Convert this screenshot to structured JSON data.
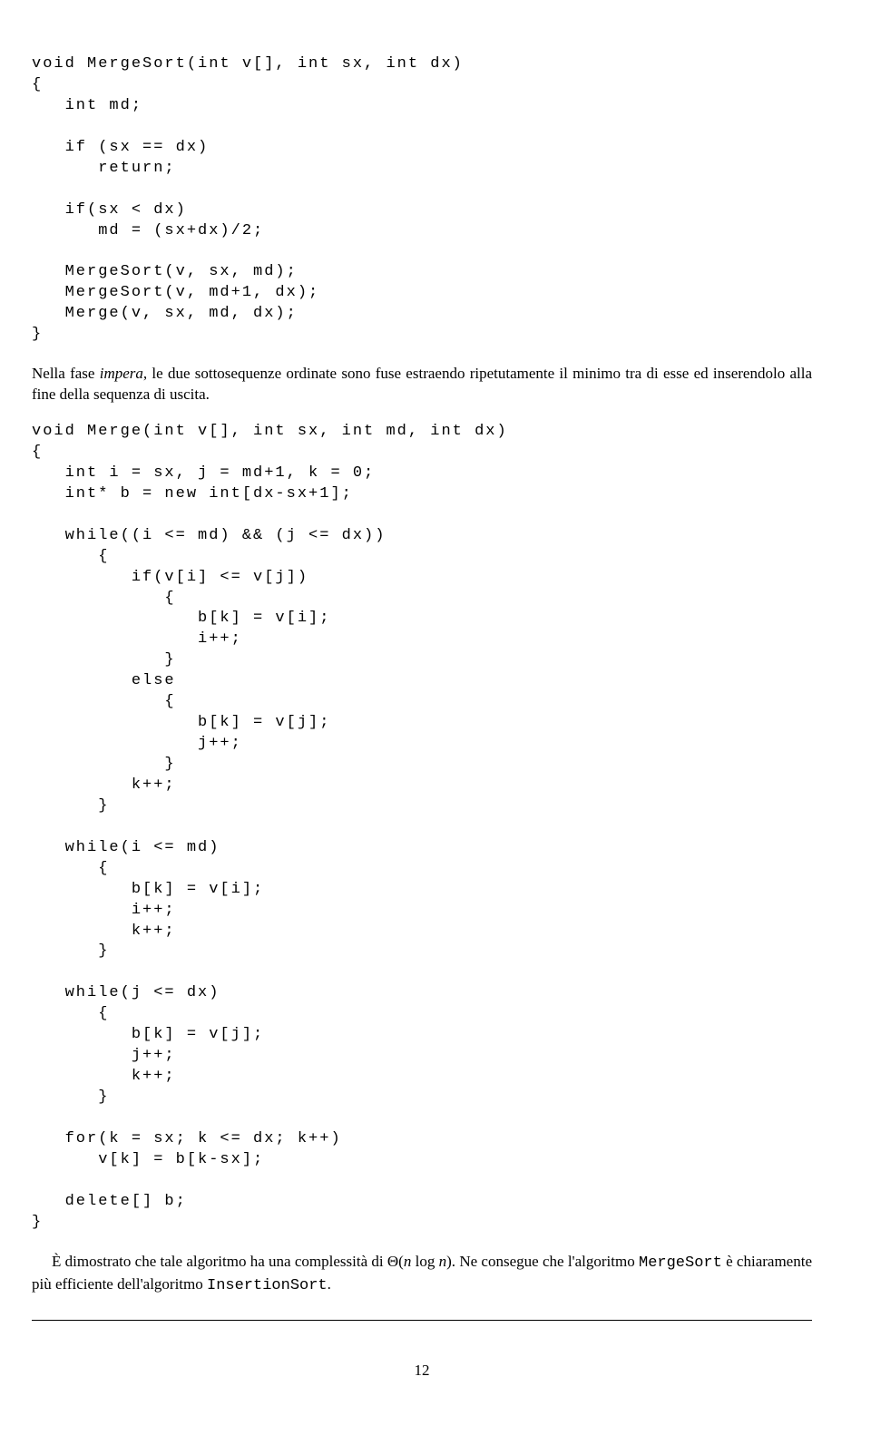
{
  "code_block_1": "void MergeSort(int v[], int sx, int dx)\n{\n   int md;\n\n   if (sx == dx)\n      return;\n\n   if(sx < dx)\n      md = (sx+dx)/2;\n\n   MergeSort(v, sx, md);\n   MergeSort(v, md+1, dx);\n   Merge(v, sx, md, dx);\n}",
  "prose_1_before_italic": "Nella fase ",
  "prose_1_italic": "impera",
  "prose_1_after_italic": ", le due sottosequenze ordinate sono fuse estraendo ripetutamente il minimo tra di esse ed inserendolo alla fine della sequenza di uscita.",
  "code_block_2": "void Merge(int v[], int sx, int md, int dx)\n{\n   int i = sx, j = md+1, k = 0;\n   int* b = new int[dx-sx+1];\n\n   while((i <= md) && (j <= dx))\n      {\n         if(v[i] <= v[j])\n            {\n               b[k] = v[i];\n               i++;\n            }\n         else\n            {\n               b[k] = v[j];\n               j++;\n            }\n         k++;\n      }\n\n   while(i <= md)\n      {\n         b[k] = v[i];\n         i++;\n         k++;\n      }\n\n   while(j <= dx)\n      {\n         b[k] = v[j];\n         j++;\n         k++;\n      }\n\n   for(k = sx; k <= dx; k++)\n      v[k] = b[k-sx];\n\n   delete[] b;\n}",
  "prose_2_a": "È dimostrato che tale algoritmo ha una complessità di Θ(",
  "prose_2_b": "n",
  "prose_2_c": " log ",
  "prose_2_d": "n",
  "prose_2_e": ").   Ne consegue che l'algoritmo ",
  "prose_2_tt1": "MergeSort",
  "prose_2_f": " è chiaramente più efficiente dell'algoritmo ",
  "prose_2_tt2": "InsertionSort",
  "prose_2_g": ".",
  "page_number": "12"
}
